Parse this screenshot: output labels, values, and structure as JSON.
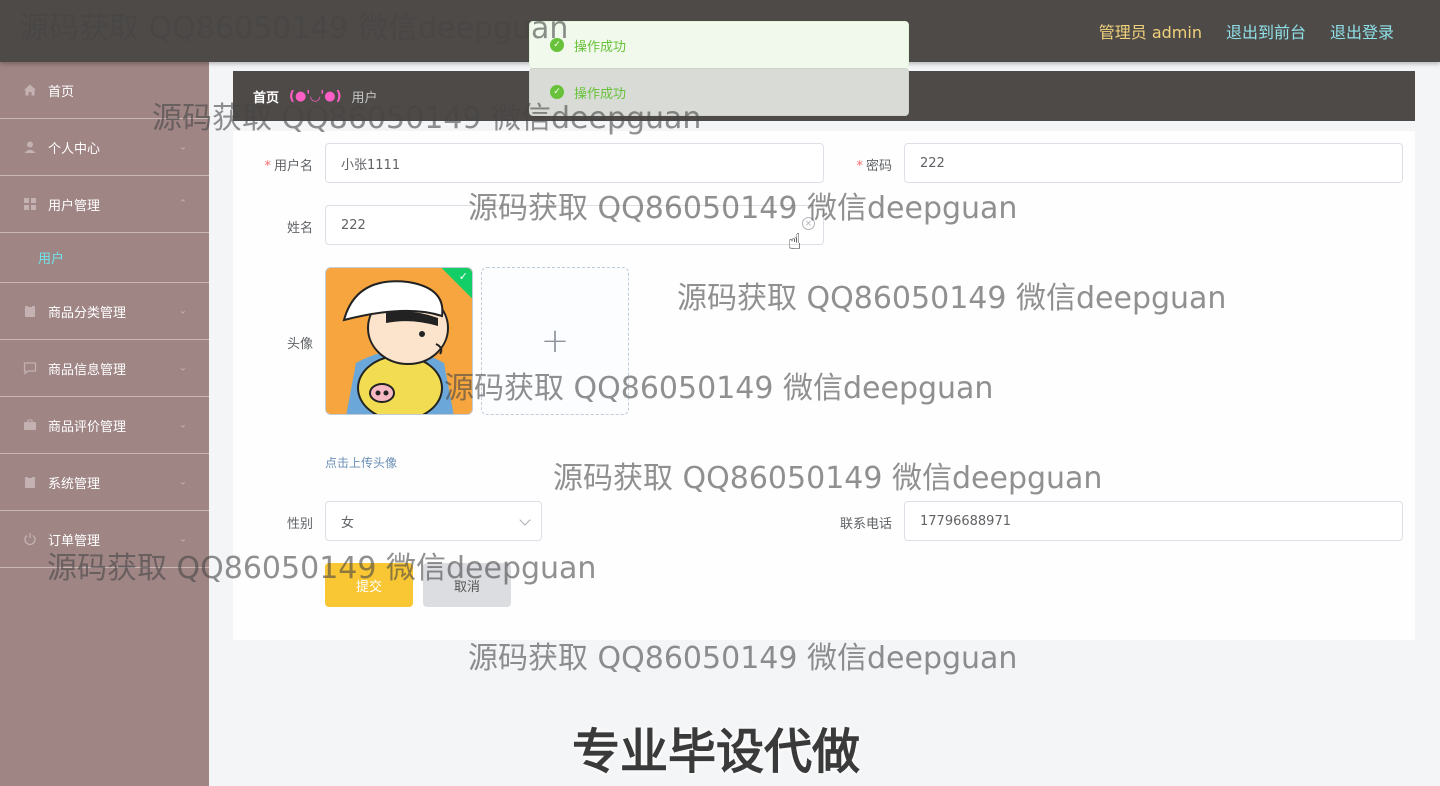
{
  "header": {
    "admin_label": "管理员 admin",
    "to_frontend": "退出到前台",
    "logout": "退出登录"
  },
  "toasts": [
    "操作成功",
    "操作成功"
  ],
  "sidebar": {
    "items": [
      {
        "label": "首页",
        "icon": "home-icon"
      },
      {
        "label": "个人中心",
        "icon": "user-icon"
      },
      {
        "label": "用户管理",
        "icon": "grid-icon"
      },
      {
        "label": "商品分类管理",
        "icon": "clipboard-icon"
      },
      {
        "label": "商品信息管理",
        "icon": "chat-icon"
      },
      {
        "label": "商品评价管理",
        "icon": "briefcase-icon"
      },
      {
        "label": "系统管理",
        "icon": "clipboard-icon"
      },
      {
        "label": "订单管理",
        "icon": "power-icon"
      }
    ],
    "active_sub": "用户"
  },
  "breadcrumb": {
    "home": "首页",
    "separator": "(●'◡'●)",
    "current": "用户"
  },
  "form": {
    "username_label": "用户名",
    "username_value": "小张1111",
    "password_label": "密码",
    "password_value": "222",
    "name_label": "姓名",
    "name_value": "222",
    "avatar_label": "头像",
    "upload_tip": "点击上传头像",
    "gender_label": "性别",
    "gender_value": "女",
    "phone_label": "联系电话",
    "phone_value": "17796688971",
    "submit_label": "提交",
    "cancel_label": "取消"
  },
  "watermark": {
    "text": "源码获取 QQ86050149 微信deepguan",
    "bottom": "专业毕设代做"
  },
  "colors": {
    "header_bg": "#4e4a48",
    "sidebar_bg": "#a08585",
    "accent_submit": "#f9c634",
    "success": "#67c23a"
  }
}
